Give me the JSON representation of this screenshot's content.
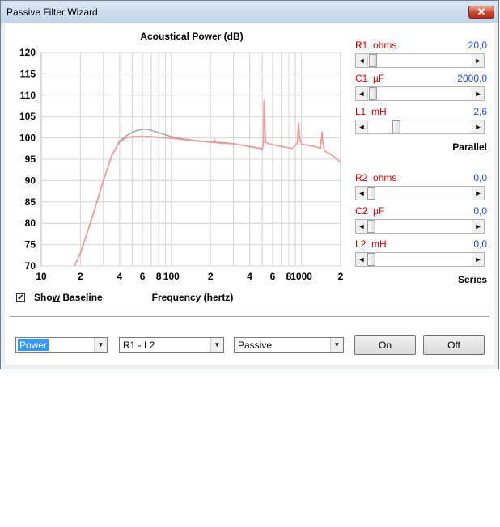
{
  "window": {
    "title": "Passive Filter Wizard",
    "close_glyph": "✕"
  },
  "chart_data": {
    "type": "line",
    "title": "Acoustical Power (dB)",
    "xlabel": "Frequency (hertz)",
    "ylabel": "",
    "x_scale": "log",
    "xlim": [
      10,
      2000
    ],
    "ylim": [
      70,
      120
    ],
    "grid": true,
    "y_ticks": [
      120,
      115,
      110,
      105,
      100,
      95,
      90,
      85,
      80,
      75,
      70
    ],
    "x_ticks": [
      {
        "v": 10,
        "label": "10"
      },
      {
        "v": 20,
        "label": "2"
      },
      {
        "v": 40,
        "label": "4"
      },
      {
        "v": 60,
        "label": "6"
      },
      {
        "v": 80,
        "label": "8"
      },
      {
        "v": 100,
        "label": "100"
      },
      {
        "v": 200,
        "label": "2"
      },
      {
        "v": 400,
        "label": "4"
      },
      {
        "v": 600,
        "label": "6"
      },
      {
        "v": 800,
        "label": "8"
      },
      {
        "v": 1000,
        "label": "1000"
      },
      {
        "v": 2000,
        "label": "2"
      }
    ],
    "series": [
      {
        "color": "#a8a8a8",
        "points": [
          [
            18,
            70
          ],
          [
            20,
            73
          ],
          [
            25,
            82
          ],
          [
            30,
            90
          ],
          [
            35,
            96
          ],
          [
            40,
            99.2
          ],
          [
            45,
            100.5
          ],
          [
            50,
            101.3
          ],
          [
            55,
            101.8
          ],
          [
            60,
            102
          ],
          [
            65,
            102
          ],
          [
            70,
            101.8
          ],
          [
            80,
            101.2
          ],
          [
            100,
            100.3
          ],
          [
            120,
            99.8
          ],
          [
            150,
            99.4
          ],
          [
            200,
            99
          ],
          [
            250,
            98.9
          ],
          [
            300,
            98.6
          ],
          [
            350,
            98.3
          ],
          [
            400,
            97.9
          ],
          [
            450,
            97.7
          ],
          [
            500,
            97.5
          ]
        ]
      },
      {
        "color": "#f09a9a",
        "points": [
          [
            18,
            70
          ],
          [
            20,
            73
          ],
          [
            25,
            82
          ],
          [
            30,
            90
          ],
          [
            35,
            96
          ],
          [
            40,
            99
          ],
          [
            45,
            100
          ],
          [
            50,
            100.3
          ],
          [
            60,
            100.4
          ],
          [
            70,
            100.3
          ],
          [
            80,
            100.1
          ],
          [
            100,
            99.9
          ],
          [
            150,
            99.3
          ],
          [
            200,
            99
          ],
          [
            210,
            98.9
          ],
          [
            215,
            99.5
          ],
          [
            220,
            98.8
          ],
          [
            300,
            98.6
          ],
          [
            400,
            98
          ],
          [
            480,
            97.5
          ],
          [
            500,
            97.2
          ],
          [
            510,
            98.5
          ],
          [
            515,
            108.8
          ],
          [
            520,
            106
          ],
          [
            530,
            99
          ],
          [
            560,
            98.6
          ],
          [
            700,
            98
          ],
          [
            850,
            97.5
          ],
          [
            900,
            98.3
          ],
          [
            930,
            98.8
          ],
          [
            950,
            103.6
          ],
          [
            970,
            100
          ],
          [
            1000,
            98.5
          ],
          [
            1200,
            98.1
          ],
          [
            1400,
            97.6
          ],
          [
            1420,
            99.5
          ],
          [
            1440,
            101.5
          ],
          [
            1460,
            99
          ],
          [
            1500,
            97
          ],
          [
            1700,
            96
          ],
          [
            2000,
            94.3
          ]
        ]
      }
    ]
  },
  "show_baseline": {
    "label_pre": "Sh",
    "label_u": "o",
    "label_mid": "",
    "label_w": "w",
    "label_post": " Baseline",
    "checked_glyph": "✔"
  },
  "slider_arrows": {
    "left": "◄",
    "right": "►"
  },
  "controls": {
    "r1": {
      "name": "R1",
      "unit": "ohms",
      "value": "20,0",
      "level": 0.02
    },
    "c1": {
      "name": "C1",
      "unit": "µF",
      "value": "2000,0",
      "level": 0.02
    },
    "l1": {
      "name": "L1",
      "unit": "mH",
      "value": "2,6",
      "level": 0.26
    },
    "group1_mode": "Parallel",
    "r2": {
      "name": "R2",
      "unit": "ohms",
      "value": "0,0",
      "level": 0.0
    },
    "c2": {
      "name": "C2",
      "unit": "µF",
      "value": "0,0",
      "level": 0.0
    },
    "l2": {
      "name": "L2",
      "unit": "mH",
      "value": "0,0",
      "level": 0.0
    },
    "group2_mode": "Series"
  },
  "bottom": {
    "measure_select": "Power",
    "path_select": "R1 - L2",
    "type_select": "Passive",
    "dropdown_glyph": "▼",
    "on_label": "On",
    "off_label": "Off"
  }
}
